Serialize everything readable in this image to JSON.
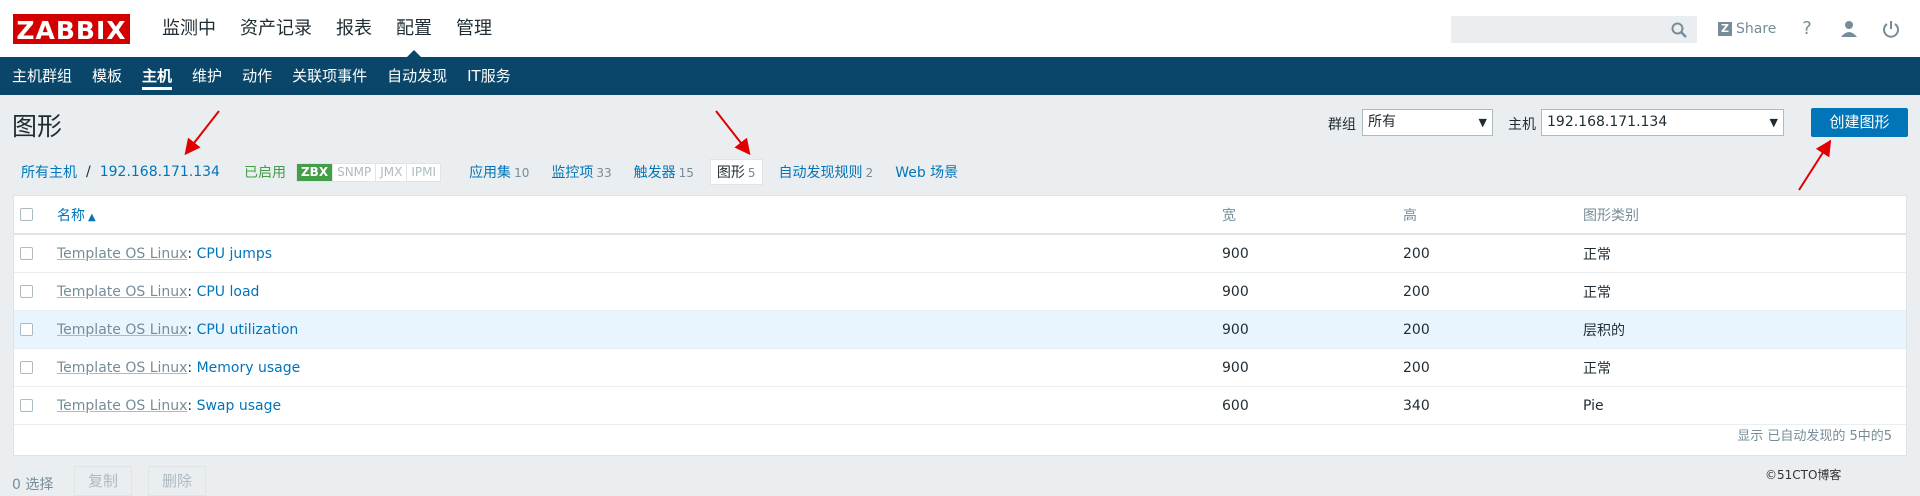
{
  "brand": {
    "logo": "ZABBIX",
    "color": "#d40000"
  },
  "main_menu": [
    "监测中",
    "资产记录",
    "报表",
    "配置",
    "管理"
  ],
  "main_menu_active": "配置",
  "header": {
    "share_label": "Share",
    "search_placeholder": ""
  },
  "sub_menu": [
    "主机群组",
    "模板",
    "主机",
    "维护",
    "动作",
    "关联项事件",
    "自动发现",
    "IT服务"
  ],
  "sub_menu_active": "主机",
  "page": {
    "title": "图形"
  },
  "filters": {
    "group_label": "群组",
    "group_value": "所有",
    "host_label": "主机",
    "host_value": "192.168.171.134",
    "create_button": "创建图形"
  },
  "host_nav": {
    "all_hosts": "所有主机",
    "separator": "/",
    "host": "192.168.171.134",
    "status": "已启用",
    "availability": [
      "ZBX",
      "SNMP",
      "JMX",
      "IPMI"
    ],
    "items": [
      {
        "label": "应用集",
        "count": "10"
      },
      {
        "label": "监控项",
        "count": "33"
      },
      {
        "label": "触发器",
        "count": "15"
      },
      {
        "label": "图形",
        "count": "5"
      },
      {
        "label": "自动发现规则",
        "count": "2"
      },
      {
        "label": "Web 场景",
        "count": ""
      }
    ]
  },
  "table": {
    "headers": {
      "name": "名称",
      "width": "宽",
      "height": "高",
      "type": "图形类别"
    },
    "rows": [
      {
        "template": "Template OS Linux",
        "sep": ": ",
        "name": "CPU jumps",
        "width": "900",
        "height": "200",
        "type": "正常"
      },
      {
        "template": "Template OS Linux",
        "sep": ": ",
        "name": "CPU load",
        "width": "900",
        "height": "200",
        "type": "正常"
      },
      {
        "template": "Template OS Linux",
        "sep": ": ",
        "name": "CPU utilization",
        "width": "900",
        "height": "200",
        "type": "层积的"
      },
      {
        "template": "Template OS Linux",
        "sep": ": ",
        "name": "Memory usage",
        "width": "900",
        "height": "200",
        "type": "正常"
      },
      {
        "template": "Template OS Linux",
        "sep": ": ",
        "name": "Swap usage",
        "width": "600",
        "height": "340",
        "type": "Pie"
      }
    ],
    "footer": "显示 已自动发现的 5中的5"
  },
  "actions": {
    "selected": "0 选择",
    "copy": "复制",
    "delete": "删除"
  },
  "watermark": "©51CTO博客",
  "colors": {
    "nav_bg": "#0a466a",
    "link": "#0275b8",
    "primary_button": "#0275b8",
    "enabled_green": "#429e47",
    "annotation_arrow": "#e00000"
  }
}
